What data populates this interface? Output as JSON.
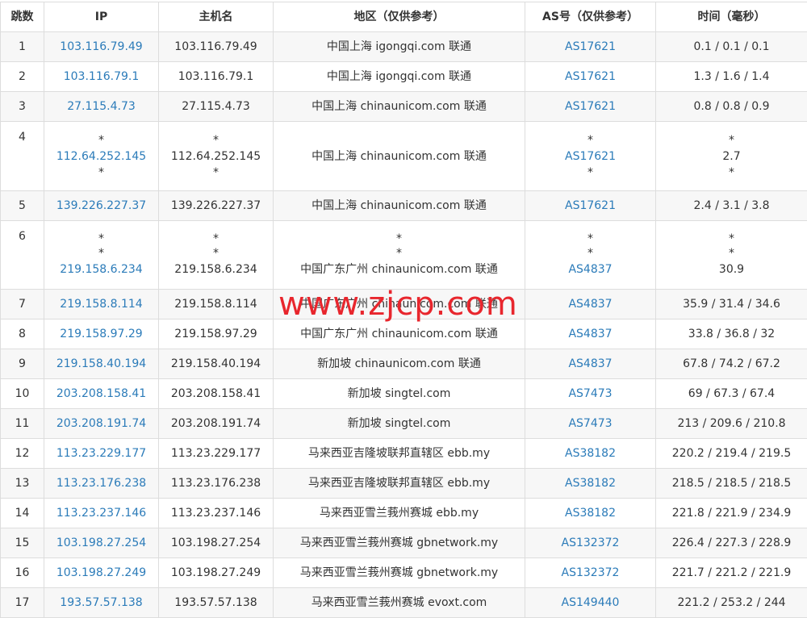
{
  "headers": {
    "hop": "跳数",
    "ip": "IP",
    "host": "主机名",
    "region": "地区（仅供参考）",
    "as": "AS号（仅供参考）",
    "time": "时间（毫秒）"
  },
  "rows": [
    {
      "hop": "1",
      "ip": [
        "103.116.79.49"
      ],
      "host": [
        "103.116.79.49"
      ],
      "region": [
        "中国上海 igongqi.com 联通"
      ],
      "as": [
        "AS17621"
      ],
      "time": [
        "0.1 / 0.1 / 0.1"
      ]
    },
    {
      "hop": "2",
      "ip": [
        "103.116.79.1"
      ],
      "host": [
        "103.116.79.1"
      ],
      "region": [
        "中国上海 igongqi.com 联通"
      ],
      "as": [
        "AS17621"
      ],
      "time": [
        "1.3 / 1.6 / 1.4"
      ]
    },
    {
      "hop": "3",
      "ip": [
        "27.115.4.73"
      ],
      "host": [
        "27.115.4.73"
      ],
      "region": [
        "中国上海 chinaunicom.com 联通"
      ],
      "as": [
        "AS17621"
      ],
      "time": [
        "0.8 / 0.8 / 0.9"
      ]
    },
    {
      "hop": "4",
      "ip": [
        "*",
        "112.64.252.145",
        "*"
      ],
      "host": [
        "*",
        "112.64.252.145",
        "*"
      ],
      "region": [
        "",
        "中国上海 chinaunicom.com 联通",
        ""
      ],
      "as": [
        "*",
        "AS17621",
        "*"
      ],
      "time": [
        "*",
        "2.7",
        "*"
      ]
    },
    {
      "hop": "5",
      "ip": [
        "139.226.227.37"
      ],
      "host": [
        "139.226.227.37"
      ],
      "region": [
        "中国上海 chinaunicom.com 联通"
      ],
      "as": [
        "AS17621"
      ],
      "time": [
        "2.4 / 3.1 / 3.8"
      ]
    },
    {
      "hop": "6",
      "ip": [
        "*",
        "*",
        "219.158.6.234"
      ],
      "host": [
        "*",
        "*",
        "219.158.6.234"
      ],
      "region": [
        "*",
        "*",
        "中国广东广州 chinaunicom.com 联通"
      ],
      "as": [
        "*",
        "*",
        "AS4837"
      ],
      "time": [
        "*",
        "*",
        "30.9"
      ]
    },
    {
      "hop": "7",
      "ip": [
        "219.158.8.114"
      ],
      "host": [
        "219.158.8.114"
      ],
      "region": [
        "中国广东广州 chinaunicom.com 联通"
      ],
      "as": [
        "AS4837"
      ],
      "time": [
        "35.9 / 31.4 / 34.6"
      ]
    },
    {
      "hop": "8",
      "ip": [
        "219.158.97.29"
      ],
      "host": [
        "219.158.97.29"
      ],
      "region": [
        "中国广东广州 chinaunicom.com 联通"
      ],
      "as": [
        "AS4837"
      ],
      "time": [
        "33.8 / 36.8 / 32"
      ]
    },
    {
      "hop": "9",
      "ip": [
        "219.158.40.194"
      ],
      "host": [
        "219.158.40.194"
      ],
      "region": [
        "新加坡 chinaunicom.com 联通"
      ],
      "as": [
        "AS4837"
      ],
      "time": [
        "67.8 / 74.2 / 67.2"
      ]
    },
    {
      "hop": "10",
      "ip": [
        "203.208.158.41"
      ],
      "host": [
        "203.208.158.41"
      ],
      "region": [
        "新加坡 singtel.com"
      ],
      "as": [
        "AS7473"
      ],
      "time": [
        "69 / 67.3 / 67.4"
      ]
    },
    {
      "hop": "11",
      "ip": [
        "203.208.191.74"
      ],
      "host": [
        "203.208.191.74"
      ],
      "region": [
        "新加坡 singtel.com"
      ],
      "as": [
        "AS7473"
      ],
      "time": [
        "213 / 209.6 / 210.8"
      ]
    },
    {
      "hop": "12",
      "ip": [
        "113.23.229.177"
      ],
      "host": [
        "113.23.229.177"
      ],
      "region": [
        "马来西亚吉隆坡联邦直辖区 ebb.my"
      ],
      "as": [
        "AS38182"
      ],
      "time": [
        "220.2 / 219.4 / 219.5"
      ]
    },
    {
      "hop": "13",
      "ip": [
        "113.23.176.238"
      ],
      "host": [
        "113.23.176.238"
      ],
      "region": [
        "马来西亚吉隆坡联邦直辖区 ebb.my"
      ],
      "as": [
        "AS38182"
      ],
      "time": [
        "218.5 / 218.5 / 218.5"
      ]
    },
    {
      "hop": "14",
      "ip": [
        "113.23.237.146"
      ],
      "host": [
        "113.23.237.146"
      ],
      "region": [
        "马来西亚雪兰莪州赛城 ebb.my"
      ],
      "as": [
        "AS38182"
      ],
      "time": [
        "221.8 / 221.9 / 234.9"
      ]
    },
    {
      "hop": "15",
      "ip": [
        "103.198.27.254"
      ],
      "host": [
        "103.198.27.254"
      ],
      "region": [
        "马来西亚雪兰莪州赛城 gbnetwork.my"
      ],
      "as": [
        "AS132372"
      ],
      "time": [
        "226.4 / 227.3 / 228.9"
      ]
    },
    {
      "hop": "16",
      "ip": [
        "103.198.27.249"
      ],
      "host": [
        "103.198.27.249"
      ],
      "region": [
        "马来西亚雪兰莪州赛城 gbnetwork.my"
      ],
      "as": [
        "AS132372"
      ],
      "time": [
        "221.7 / 221.2 / 221.9"
      ]
    },
    {
      "hop": "17",
      "ip": [
        "193.57.57.138"
      ],
      "host": [
        "193.57.57.138"
      ],
      "region": [
        "马来西亚雪兰莪州赛城 evoxt.com"
      ],
      "as": [
        "AS149440"
      ],
      "time": [
        "221.2 / 253.2 / 244"
      ]
    }
  ],
  "watermark": "www.zjcp.com",
  "colors": {
    "link": "#2b7bb9",
    "text": "#333333",
    "row_stripe": "#f7f7f7",
    "border": "#dddddd",
    "watermark": "#e8262d"
  }
}
